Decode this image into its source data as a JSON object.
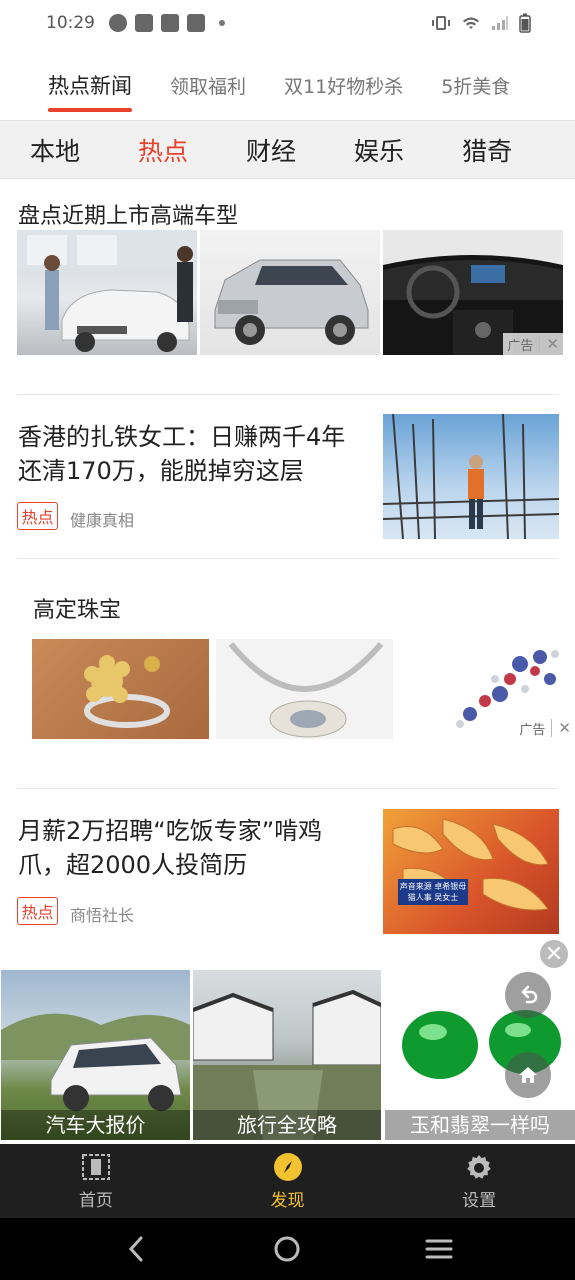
{
  "status_bar": {
    "time": "10:29"
  },
  "top_tabs": [
    "热点新闻",
    "领取福利",
    "双11好物秒杀",
    "5折美食"
  ],
  "category_tabs": [
    "本地",
    "热点",
    "财经",
    "娱乐",
    "猎奇"
  ],
  "feed": {
    "ad1": {
      "title": "盘点近期上市高端车型",
      "ad_label": "广告"
    },
    "news1": {
      "title": "香港的扎铁女工：日赚两千4年还清170万，能脱掉穷这层",
      "tag": "热点",
      "source": "健康真相"
    },
    "ad2": {
      "title": "高定珠宝",
      "ad_label": "广告"
    },
    "news2": {
      "title": "月薪2万招聘“吃饭专家”啃鸡爪，超2000人投简历",
      "tag": "热点",
      "source": "商悟社长",
      "caption": "声音来源 卓希银母猫人事 吴女士"
    }
  },
  "float_banner": {
    "items": [
      "汽车大报价",
      "旅行全攻略",
      "玉和翡翠一样吗"
    ]
  },
  "bottom_nav": {
    "items": [
      "首页",
      "发现",
      "设置"
    ]
  },
  "colors": {
    "accent": "#e8412c",
    "nav_active": "#f2c230",
    "nav_bg": "#1f1f1f"
  }
}
